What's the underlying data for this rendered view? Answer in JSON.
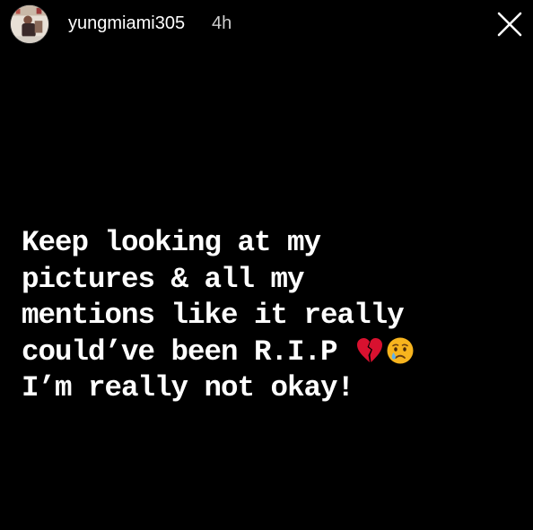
{
  "header": {
    "username": "yungmiami305",
    "timestamp": "4h",
    "avatar_icon": "profile-avatar",
    "close_icon": "close-icon"
  },
  "story": {
    "lines": [
      "Keep looking at my",
      "pictures & all my",
      "mentions like it really",
      "could’ve been R.I.P",
      "I’m really not okay!"
    ],
    "emojis_after_line_4": [
      "broken-heart-emoji",
      "crying-face-emoji"
    ]
  },
  "colors": {
    "background": "#000000",
    "text": "#ffffff",
    "timestamp": "#cfcfcf",
    "broken_heart": "#d8112f",
    "crying_face": "#f7b41e",
    "tear": "#5eb3f0"
  }
}
